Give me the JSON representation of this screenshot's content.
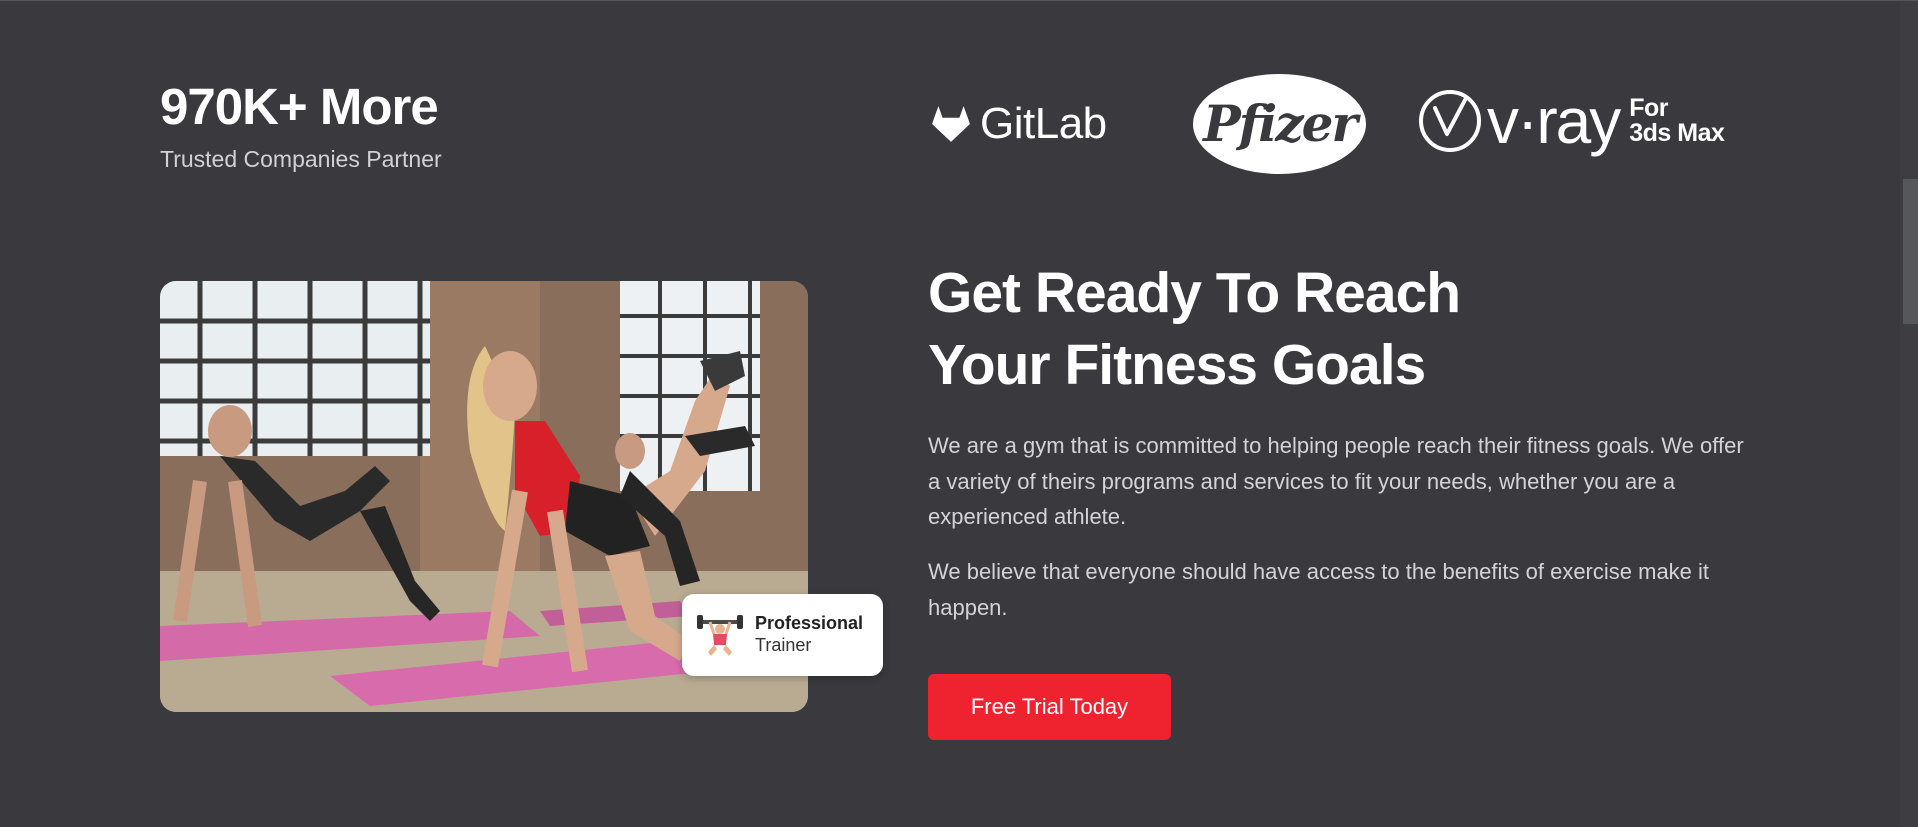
{
  "stats": {
    "headline": "970K+ More",
    "subtitle": "Trusted Companies Partner"
  },
  "partners": {
    "gitlab": "GitLab",
    "pfizer": "Pfizer",
    "vray": {
      "name": "v·ray",
      "suffix_line1": "For",
      "suffix_line2": "3ds Max"
    }
  },
  "hero": {
    "heading_line1": "Get Ready To Reach",
    "heading_line2": "Your Fitness Goals",
    "paragraph1": "We are a gym that is committed to helping people reach their fitness goals. We offer a variety of theirs programs and services to fit your needs, whether you are a experienced athlete.",
    "paragraph2": "We believe that everyone should have access to the benefits of exercise make it happen.",
    "cta_label": "Free Trial Today"
  },
  "badge": {
    "title": "Professional",
    "subtitle": "Trainer",
    "icon": "weightlifter-icon"
  },
  "colors": {
    "background": "#3a3a3e",
    "accent": "#ef2330",
    "heading": "#ffffff",
    "body_text": "#d4d4d8"
  }
}
